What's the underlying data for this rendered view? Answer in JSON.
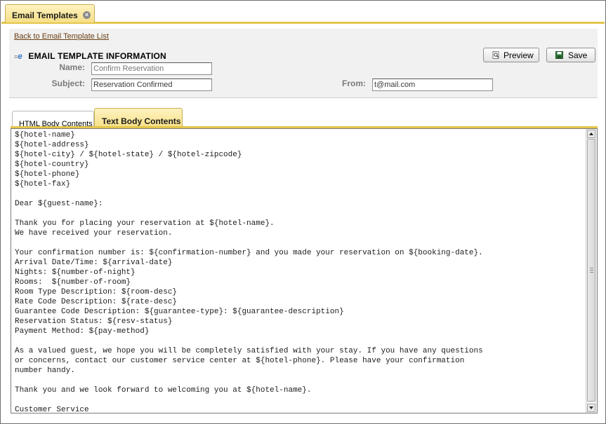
{
  "top_tab": {
    "label": "Email Templates",
    "close_icon": "close-icon"
  },
  "info": {
    "back_link": "Back to Email Template List",
    "section_title": "EMAIL TEMPLATE INFORMATION",
    "name_label": "Name:",
    "name_placeholder": "Confirm Reservation",
    "subject_label": "Subject:",
    "subject_value": "Reservation Confirmed",
    "from_label": "From:",
    "from_value": "t@mail.com"
  },
  "toolbar": {
    "preview_label": "Preview",
    "save_label": "Save",
    "preview_icon": "preview-icon",
    "save_icon": "floppy-disk-icon"
  },
  "body_tabs": [
    {
      "label": "HTML Body Contents",
      "active": false
    },
    {
      "label": "Text Body Contents",
      "active": true
    }
  ],
  "text_body": "${hotel-name}\n${hotel-address}\n${hotel-city} / ${hotel-state} / ${hotel-zipcode}\n${hotel-country}\n${hotel-phone}\n${hotel-fax}\n\nDear ${guest-name}:\n\nThank you for placing your reservation at ${hotel-name}.\nWe have received your reservation.\n\nYour confirmation number is: ${confirmation-number} and you made your reservation on ${booking-date}.\nArrival Date/Time: ${arrival-date}\nNights: ${number-of-night}\nRooms:  ${number-of-room}\nRoom Type Description: ${room-desc}\nRate Code Description: ${rate-desc}\nGuarantee Code Description: ${guarantee-type}: ${guarantee-description}\nReservation Status: ${resv-status}\nPayment Method: ${pay-method}\n\nAs a valued guest, we hope you will be completely satisfied with your stay. If you have any questions\nor concerns, contact our customer service center at ${hotel-phone}. Please have your confirmation\nnumber handy.\n\nThank you and we look forward to welcoming you at ${hotel-name}.\n\nCustomer Service",
  "colors": {
    "accent": "#e3c64c",
    "tab_fill": "#f6df86",
    "panel_bg": "#f1f1f1",
    "link": "#6a3f12",
    "label_gray": "#7a7a7a"
  }
}
